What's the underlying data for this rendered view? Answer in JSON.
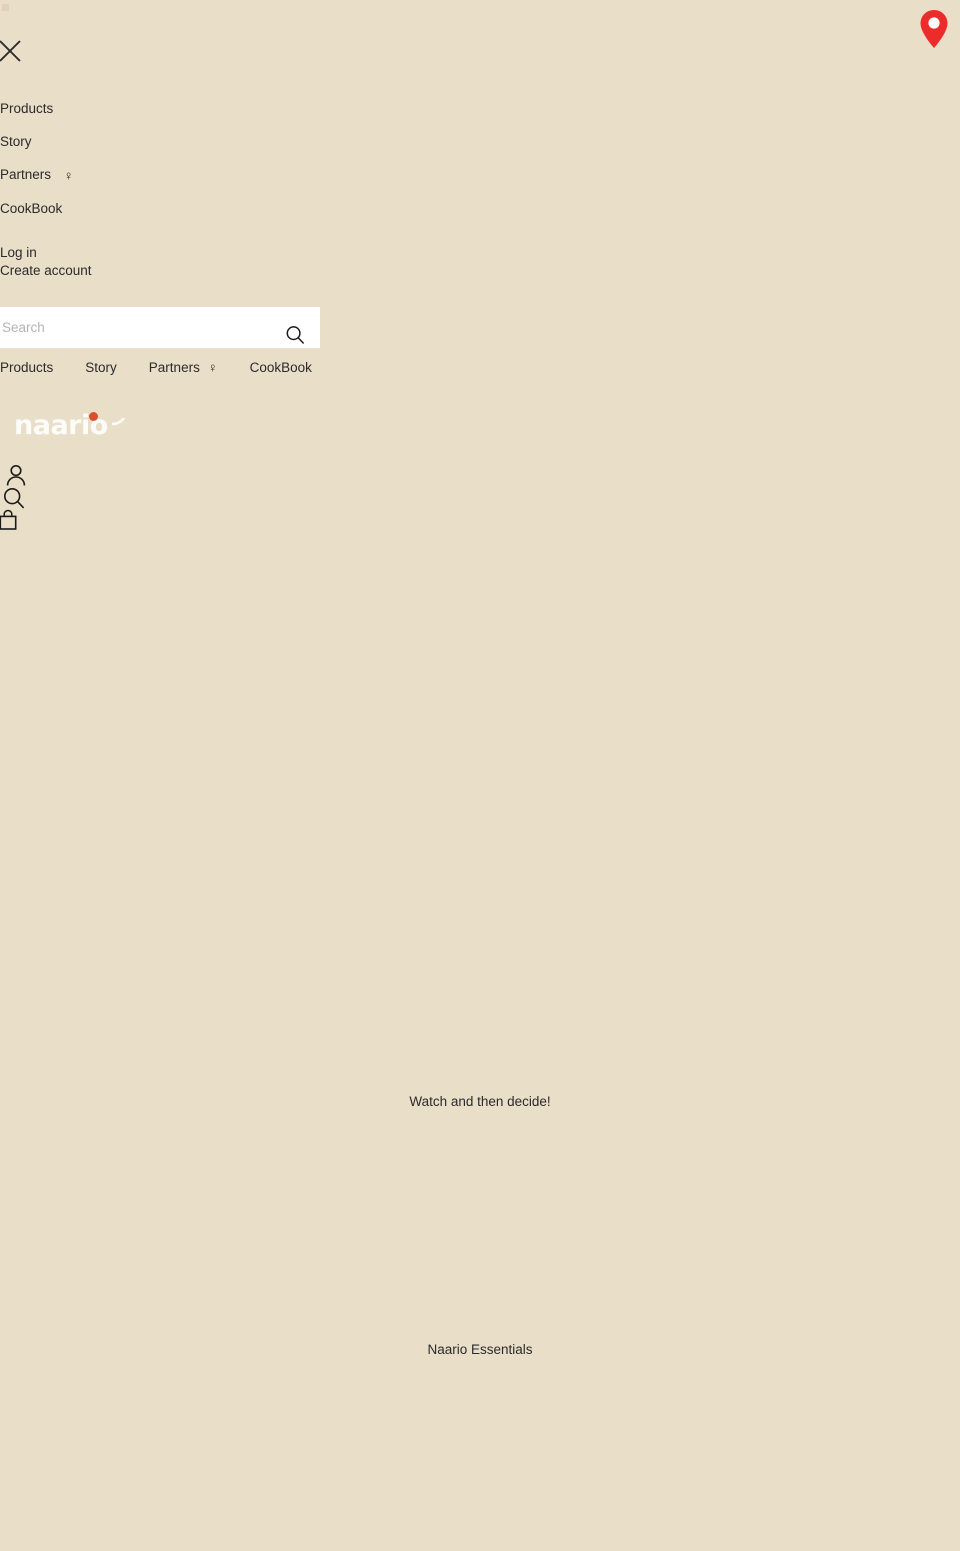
{
  "page": {
    "background_color": "#e9dec8",
    "accent_color": "#d9512c",
    "text_color": "#2b2b2b"
  },
  "map_pin": {
    "icon": "map-pin-icon",
    "color": "#ee2b2b"
  },
  "drawer": {
    "close_icon": "close-icon",
    "nav_items": [
      {
        "label": "Products",
        "icon": ""
      },
      {
        "label": "Story",
        "icon": ""
      },
      {
        "label": "Partners",
        "icon": "venus-icon",
        "glyph": "♀"
      },
      {
        "label": "CookBook",
        "icon": ""
      }
    ],
    "account": {
      "login_label": "Log in",
      "create_label": "Create account"
    }
  },
  "search": {
    "placeholder": "Search",
    "value": "",
    "submit_icon": "search-icon"
  },
  "topnav": {
    "items": [
      {
        "label": "Products",
        "icon": ""
      },
      {
        "label": "Story",
        "icon": ""
      },
      {
        "label": "Partners",
        "icon": "venus-icon",
        "glyph": "♀"
      },
      {
        "label": "CookBook",
        "icon": ""
      }
    ]
  },
  "brand": {
    "word": "naario",
    "dot_color": "#d9512c",
    "word_color": "#ffffff"
  },
  "utility_icons": [
    {
      "name": "account-icon",
      "label": "Account"
    },
    {
      "name": "search-icon",
      "label": "Search"
    },
    {
      "name": "shopping-bag-icon",
      "label": "Cart"
    }
  ],
  "main": {
    "watch_caption": "Watch and then decide!",
    "essentials_caption": "Naario Essentials"
  }
}
